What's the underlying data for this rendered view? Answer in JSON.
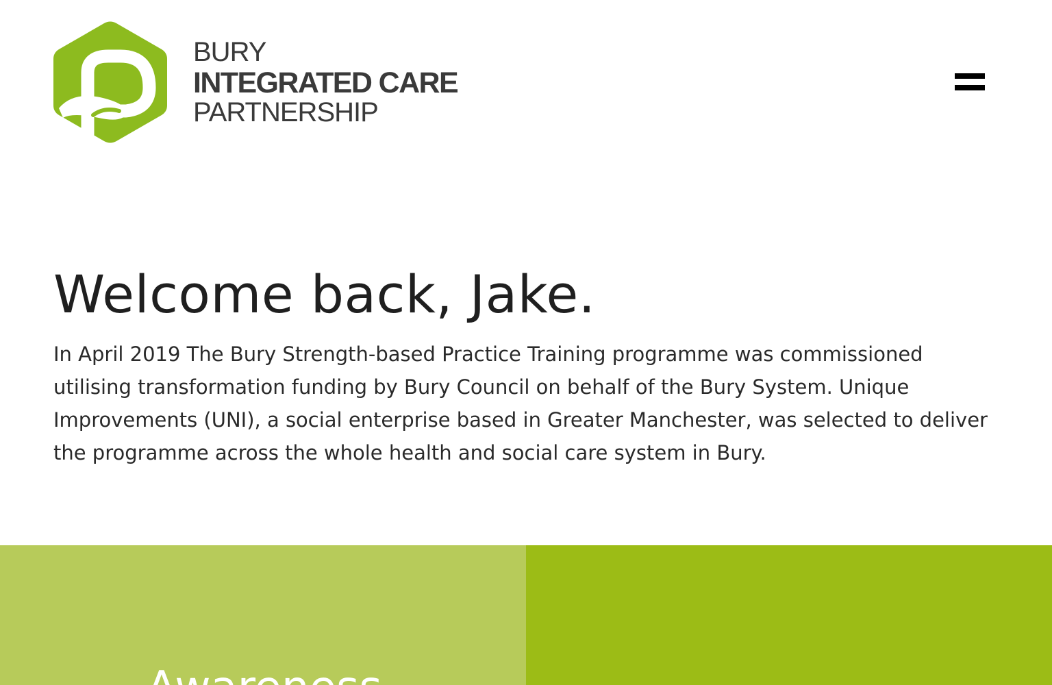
{
  "brand": {
    "line1": "BURY",
    "line2": "INTEGRATED CARE",
    "line3": "PARTNERSHIP",
    "accent_color": "#8dbb1f"
  },
  "nav": {
    "menu_icon": "hamburger-icon"
  },
  "hero": {
    "heading": "Welcome back, Jake.",
    "intro": "In April 2019 The Bury Strength-based Practice Training programme was commissioned utilising transformation funding by Bury Council on behalf of the Bury System. Unique Improvements (UNI), a social enterprise based in Greater Manchester, was selected to deliver the programme across the whole health and social care system in Bury."
  },
  "panels": {
    "left": {
      "color": "#b7cb5a",
      "heading": "Awareness"
    },
    "right": {
      "color": "#9cbc16"
    }
  }
}
